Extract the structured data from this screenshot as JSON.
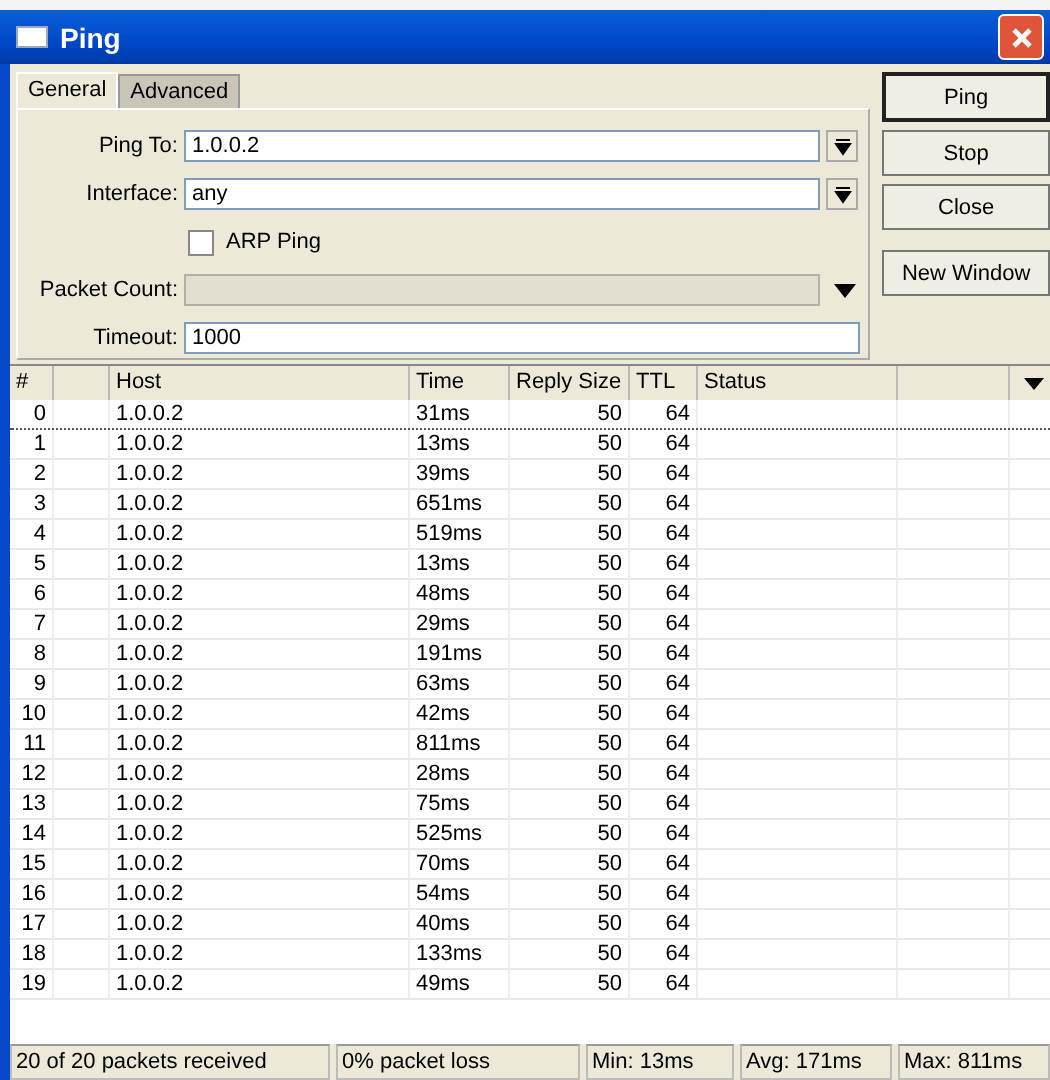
{
  "window": {
    "title": "Ping"
  },
  "tabs": [
    {
      "label": "General",
      "selected": true
    },
    {
      "label": "Advanced",
      "selected": false
    }
  ],
  "form": {
    "ping_to": {
      "label": "Ping To:",
      "value": "1.0.0.2"
    },
    "interface": {
      "label": "Interface:",
      "value": "any"
    },
    "arp_ping": {
      "label": "ARP Ping",
      "checked": false
    },
    "packet_count": {
      "label": "Packet Count:",
      "disabled": true
    },
    "timeout": {
      "label": "Timeout:",
      "value": "1000"
    }
  },
  "buttons": [
    "Ping",
    "Stop",
    "Close",
    "New Window"
  ],
  "table": {
    "columns": [
      "#",
      "",
      "Host",
      "Time",
      "Reply Size",
      "TTL",
      "Status",
      ""
    ],
    "rows": [
      {
        "n": "0",
        "host": "1.0.0.2",
        "time": "31ms",
        "size": "50",
        "ttl": "64",
        "selected": true
      },
      {
        "n": "1",
        "host": "1.0.0.2",
        "time": "13ms",
        "size": "50",
        "ttl": "64",
        "selected": false
      },
      {
        "n": "2",
        "host": "1.0.0.2",
        "time": "39ms",
        "size": "50",
        "ttl": "64",
        "selected": false
      },
      {
        "n": "3",
        "host": "1.0.0.2",
        "time": "651ms",
        "size": "50",
        "ttl": "64",
        "selected": false
      },
      {
        "n": "4",
        "host": "1.0.0.2",
        "time": "519ms",
        "size": "50",
        "ttl": "64",
        "selected": false
      },
      {
        "n": "5",
        "host": "1.0.0.2",
        "time": "13ms",
        "size": "50",
        "ttl": "64",
        "selected": false
      },
      {
        "n": "6",
        "host": "1.0.0.2",
        "time": "48ms",
        "size": "50",
        "ttl": "64",
        "selected": false
      },
      {
        "n": "7",
        "host": "1.0.0.2",
        "time": "29ms",
        "size": "50",
        "ttl": "64",
        "selected": false
      },
      {
        "n": "8",
        "host": "1.0.0.2",
        "time": "191ms",
        "size": "50",
        "ttl": "64",
        "selected": false
      },
      {
        "n": "9",
        "host": "1.0.0.2",
        "time": "63ms",
        "size": "50",
        "ttl": "64",
        "selected": false
      },
      {
        "n": "10",
        "host": "1.0.0.2",
        "time": "42ms",
        "size": "50",
        "ttl": "64",
        "selected": false
      },
      {
        "n": "11",
        "host": "1.0.0.2",
        "time": "811ms",
        "size": "50",
        "ttl": "64",
        "selected": false
      },
      {
        "n": "12",
        "host": "1.0.0.2",
        "time": "28ms",
        "size": "50",
        "ttl": "64",
        "selected": false
      },
      {
        "n": "13",
        "host": "1.0.0.2",
        "time": "75ms",
        "size": "50",
        "ttl": "64",
        "selected": false
      },
      {
        "n": "14",
        "host": "1.0.0.2",
        "time": "525ms",
        "size": "50",
        "ttl": "64",
        "selected": false
      },
      {
        "n": "15",
        "host": "1.0.0.2",
        "time": "70ms",
        "size": "50",
        "ttl": "64",
        "selected": false
      },
      {
        "n": "16",
        "host": "1.0.0.2",
        "time": "54ms",
        "size": "50",
        "ttl": "64",
        "selected": false
      },
      {
        "n": "17",
        "host": "1.0.0.2",
        "time": "40ms",
        "size": "50",
        "ttl": "64",
        "selected": false
      },
      {
        "n": "18",
        "host": "1.0.0.2",
        "time": "133ms",
        "size": "50",
        "ttl": "64",
        "selected": false
      },
      {
        "n": "19",
        "host": "1.0.0.2",
        "time": "49ms",
        "size": "50",
        "ttl": "64",
        "selected": false
      }
    ]
  },
  "status_bar": [
    "20 of 20 packets received",
    "0% packet loss",
    "Min: 13ms",
    "Avg: 171ms",
    "Max: 811ms"
  ]
}
